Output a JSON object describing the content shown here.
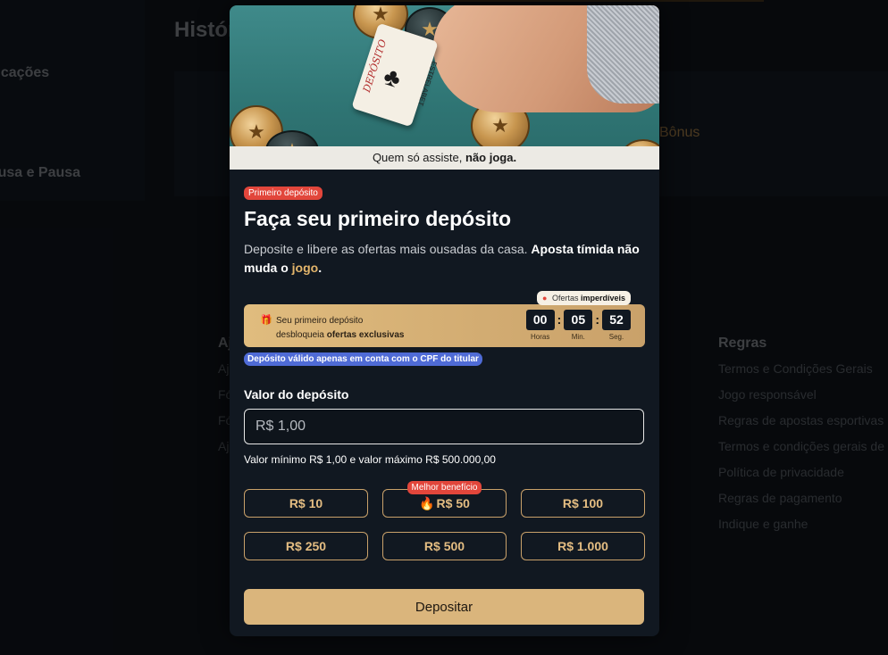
{
  "background": {
    "header_title": "Históricos",
    "sidebar_items": [
      "Notificações",
      "Pausa e Pausa"
    ],
    "bonus_text": "Bônus",
    "footer": {
      "col_left": {
        "title": "Ajuda",
        "links": [
          "Ajuda",
          "Fórum",
          "Fórum",
          "Ajuda"
        ]
      },
      "col_rules": {
        "title": "Regras",
        "links": [
          "Termos e Condições Gerais",
          "Jogo responsável",
          "Regras de apostas esportivas",
          "Termos e condições gerais de",
          "Política de privacidade",
          "Regras de pagamento",
          "Indique e ganhe"
        ]
      }
    }
  },
  "modal": {
    "hero": {
      "tagline_prefix": "Quem só assiste,",
      "tagline_bold": "não joga.",
      "card_text": "DEPÓSITO",
      "card_brand": "ESTRELABET"
    },
    "badge": "Primeiro depósito",
    "title": "Faça seu primeiro depósito",
    "subtitle_part1": "Deposite e libere as ofertas mais ousadas da casa.",
    "subtitle_bold": "Aposta tímida não muda o",
    "subtitle_gold": "jogo",
    "subtitle_end": ".",
    "offer": {
      "pill_prefix": "Ofertas",
      "pill_bold": "imperdíveis",
      "line1": "Seu primeiro depósito",
      "line2_prefix": "desbloqueia",
      "line2_bold": "ofertas exclusivas",
      "timer": {
        "hours": "00",
        "minutes": "05",
        "seconds": "52",
        "hours_label": "Horas",
        "minutes_label": "Min.",
        "seconds_label": "Seg."
      }
    },
    "cpf_notice": "Depósito válido apenas em conta com o CPF do titular",
    "amount_label": "Valor do depósito",
    "amount_placeholder": "R$ 1,00",
    "amount_hint": "Valor mínimo R$ 1,00 e valor máximo R$ 500.000,00",
    "amounts": [
      "R$ 10",
      "R$ 50",
      "R$ 100",
      "R$ 250",
      "R$ 500",
      "R$ 1.000"
    ],
    "best_badge": "Melhor benefício",
    "deposit_button": "Depositar"
  },
  "colors": {
    "accent_gold": "#dab57c",
    "badge_red": "#e2463b",
    "badge_blue": "#4f6bd6",
    "modal_bg": "#111821"
  }
}
